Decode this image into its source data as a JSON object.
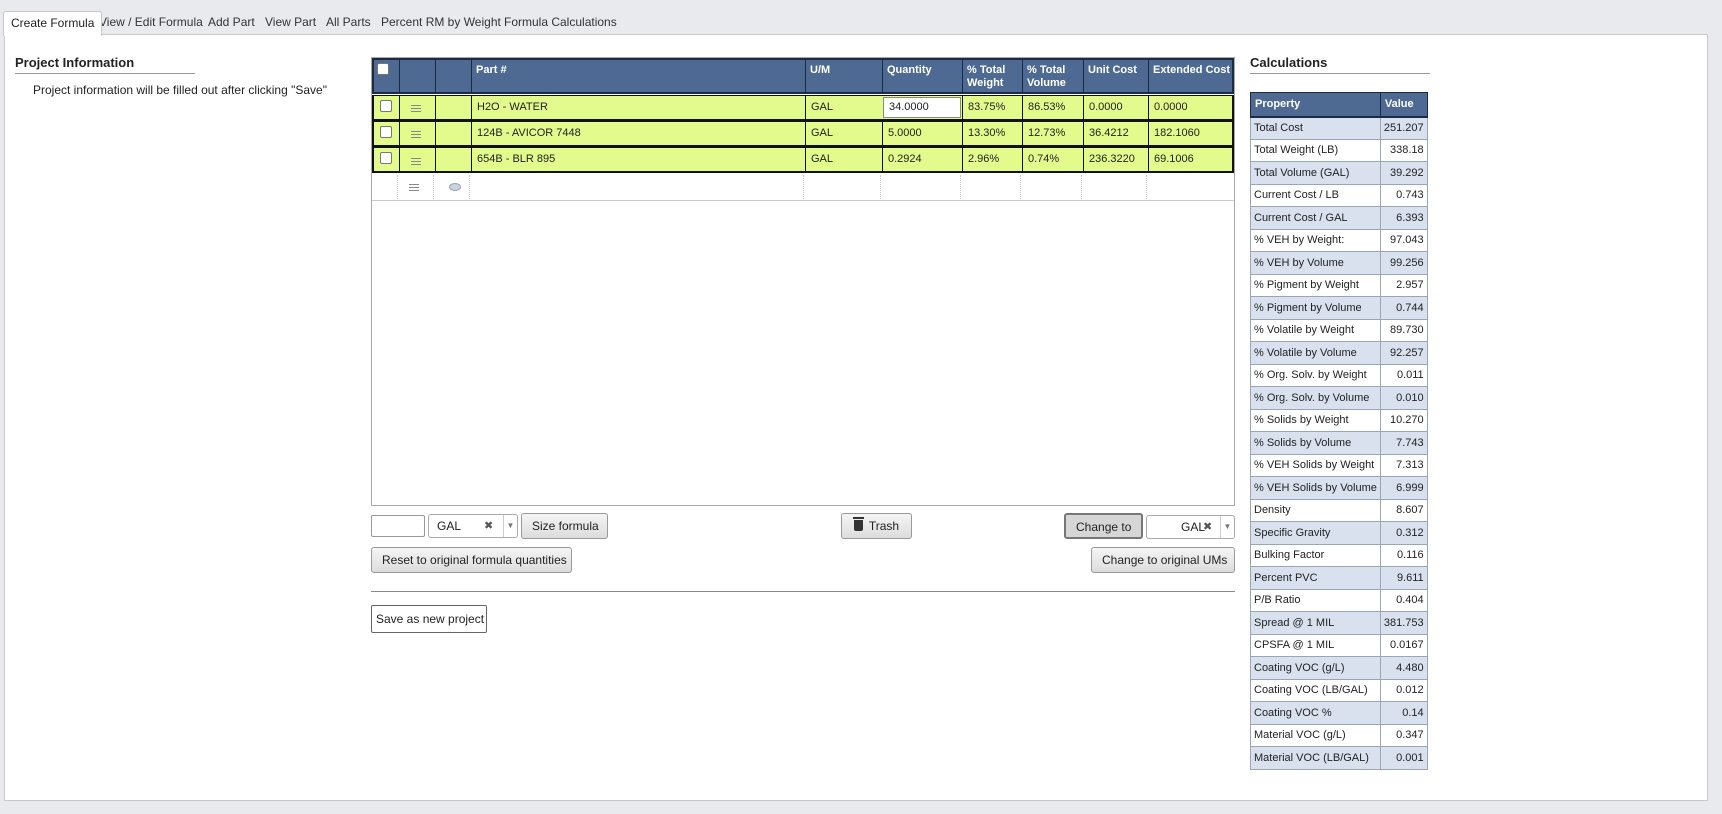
{
  "tabs": [
    {
      "label": "Create Formula",
      "active": true
    },
    {
      "label": "View / Edit Formula"
    },
    {
      "label": "Add Part"
    },
    {
      "label": "View Part"
    },
    {
      "label": "All Parts"
    },
    {
      "label": "Percent RM by Weight"
    },
    {
      "label": "Formula Calculations"
    }
  ],
  "project": {
    "title": "Project Information",
    "note": "Project information will be filled out after clicking \"Save\""
  },
  "grid": {
    "columns": [
      "Part #",
      "U/M",
      "Quantity",
      "% Total Weight",
      "% Total Volume",
      "Unit Cost",
      "Extended Cost"
    ],
    "rows": [
      {
        "part": "H2O - WATER",
        "um": "GAL",
        "quantity": "34.0000",
        "pct_weight": "83.75%",
        "pct_volume": "86.53%",
        "unit_cost": "0.0000",
        "ext_cost": "0.0000"
      },
      {
        "part": "124B - AVICOR 7448",
        "um": "GAL",
        "quantity": "5.0000",
        "pct_weight": "13.30%",
        "pct_volume": "12.73%",
        "unit_cost": "36.4212",
        "ext_cost": "182.1060"
      },
      {
        "part": "654B - BLR 895",
        "um": "GAL",
        "quantity": "0.2924",
        "pct_weight": "2.96%",
        "pct_volume": "0.74%",
        "unit_cost": "236.3220",
        "ext_cost": "69.1006"
      }
    ]
  },
  "controls": {
    "size_input_value": "",
    "size_um": "GAL",
    "size_button": "Size formula",
    "trash_button": "Trash",
    "change_to_button": "Change to",
    "change_um": "GAL",
    "reset_button": "Reset to original formula quantities",
    "change_original_button": "Change to original UMs",
    "save_new_button": "Save as new project"
  },
  "calculations": {
    "title": "Calculations",
    "header_property": "Property",
    "header_value": "Value",
    "rows": [
      {
        "label": "Total Cost",
        "value": "251.207"
      },
      {
        "label": "Total Weight (LB)",
        "value": "338.18"
      },
      {
        "label": "Total Volume (GAL)",
        "value": "39.292"
      },
      {
        "label": "Current Cost / LB",
        "value": "0.743"
      },
      {
        "label": "Current Cost / GAL",
        "value": "6.393"
      },
      {
        "label": "% VEH by Weight:",
        "value": "97.043"
      },
      {
        "label": "% VEH by Volume",
        "value": "99.256"
      },
      {
        "label": "% Pigment by Weight",
        "value": "2.957"
      },
      {
        "label": "% Pigment by Volume",
        "value": "0.744"
      },
      {
        "label": "% Volatile by Weight",
        "value": "89.730"
      },
      {
        "label": "% Volatile by Volume",
        "value": "92.257"
      },
      {
        "label": "% Org. Solv. by Weight",
        "value": "0.011"
      },
      {
        "label": "% Org. Solv. by Volume",
        "value": "0.010"
      },
      {
        "label": "% Solids by Weight",
        "value": "10.270"
      },
      {
        "label": "% Solids by Volume",
        "value": "7.743"
      },
      {
        "label": "% VEH Solids by Weight",
        "value": "7.313"
      },
      {
        "label": "% VEH Solids by Volume",
        "value": "6.999"
      },
      {
        "label": "Density",
        "value": "8.607"
      },
      {
        "label": "Specific Gravity",
        "value": "0.312"
      },
      {
        "label": "Bulking Factor",
        "value": "0.116"
      },
      {
        "label": "Percent PVC",
        "value": "9.611"
      },
      {
        "label": "P/B Ratio",
        "value": "0.404"
      },
      {
        "label": "Spread @ 1 MIL",
        "value": "381.753"
      },
      {
        "label": "CPSFA @ 1 MIL",
        "value": "0.0167"
      },
      {
        "label": "Coating VOC (g/L)",
        "value": "4.480"
      },
      {
        "label": "Coating VOC (LB/GAL)",
        "value": "0.012"
      },
      {
        "label": "Coating VOC %",
        "value": "0.14"
      },
      {
        "label": "Material VOC (g/L)",
        "value": "0.347"
      },
      {
        "label": "Material VOC (LB/GAL)",
        "value": "0.001"
      }
    ]
  },
  "colors": {
    "header_bg": "#4e6a93",
    "row_highlight": "#e3fb8c",
    "alt_row": "#d9e1ef"
  }
}
